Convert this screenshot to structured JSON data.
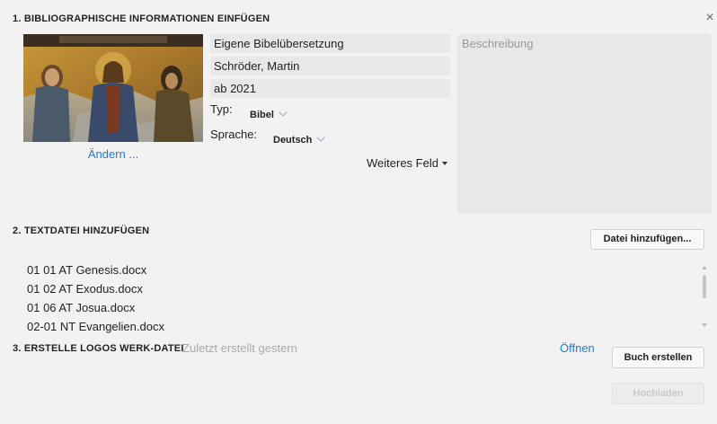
{
  "section1": {
    "title": "1. BIBLIOGRAPHISCHE INFORMATIONEN EINFÜGEN",
    "change_link": "Ändern ...",
    "fields": {
      "title_value": "Eigene Bibelübersetzung",
      "author_value": "Schröder, Martin",
      "date_value": "ab 2021"
    },
    "type_label": "Typ:",
    "type_value": "Bibel",
    "language_label": "Sprache:",
    "language_value": "Deutsch",
    "more_field": "Weiteres Feld",
    "description_placeholder": "Beschreibung"
  },
  "section2": {
    "title": "2. TEXTDATEI HINZUFÜGEN",
    "add_file_button": "Datei hinzufügen...",
    "files": [
      "01 01 AT Genesis.docx",
      "01 02 AT Exodus.docx",
      "01 06 AT Josua.docx",
      "02-01 NT Evangelien.docx"
    ]
  },
  "section3": {
    "title": "3. ERSTELLE LOGOS WERK-DATEI",
    "status": "Zuletzt erstellt gestern",
    "open_link": "Öffnen",
    "create_button": "Buch erstellen",
    "upload_button": "Hochladen"
  },
  "icons": {
    "close": "close-icon",
    "cover": "cover-image-icon",
    "dropdown": "chevron-down-icon",
    "menu_caret": "caret-down-icon"
  },
  "colors": {
    "background": "#f2f2f2",
    "field_bg": "#e8e8e8",
    "link": "#1f7dd0",
    "placeholder": "#9a9a9a"
  }
}
